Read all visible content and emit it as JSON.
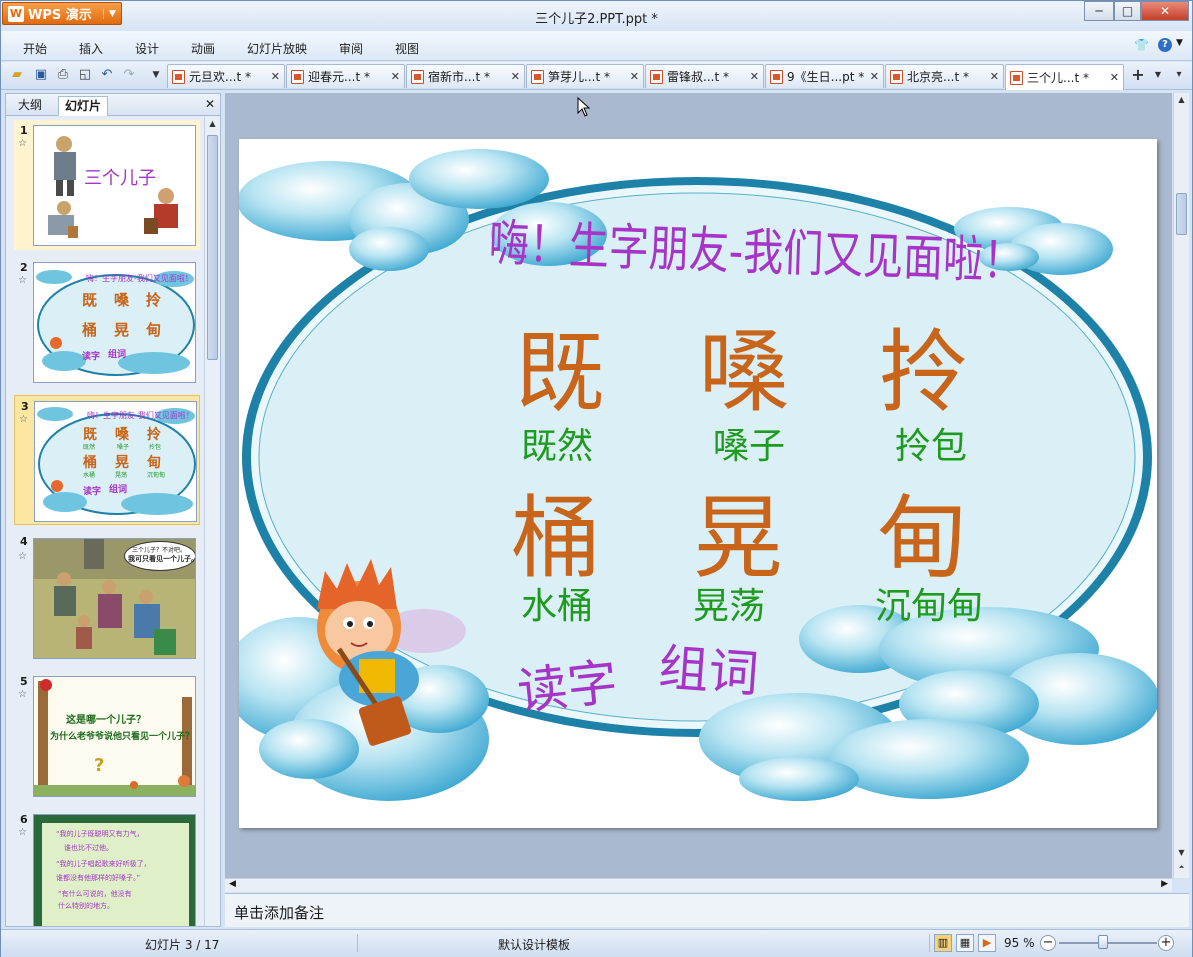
{
  "app": {
    "name": "WPS 演示",
    "window_title": "三个儿子2.PPT.ppt *",
    "controls": {
      "minimize": "─",
      "maximize": "□",
      "close": "✕"
    }
  },
  "menu": [
    "开始",
    "插入",
    "设计",
    "动画",
    "幻灯片放映",
    "审阅",
    "视图"
  ],
  "menu_right": {
    "shirt": "👕",
    "help": "?"
  },
  "toolbar": {
    "icons": [
      "open-icon",
      "save-icon",
      "print-icon",
      "preview-icon",
      "undo-icon",
      "redo-icon",
      "dropdown-icon"
    ],
    "tabs": [
      {
        "label": "元旦欢...t *"
      },
      {
        "label": "迎春元...t *"
      },
      {
        "label": "宿新市...t *"
      },
      {
        "label": "笋芽儿...t *"
      },
      {
        "label": "雷锋叔...t *"
      },
      {
        "label": "9《生日...pt *"
      },
      {
        "label": "北京亮...t *"
      },
      {
        "label": "三个儿...t *",
        "active": true
      }
    ],
    "tab_close": "✕",
    "new_tab": "+"
  },
  "panel": {
    "tabs": [
      "大纲",
      "幻灯片"
    ],
    "active_tab": "幻灯片",
    "close": "✕"
  },
  "thumbnails": [
    {
      "num": "1",
      "title": "三个儿子"
    },
    {
      "num": "2",
      "title": "嗨！生字朋友-我们又见面啦！",
      "chars": [
        "既",
        "嗓",
        "拎",
        "桶",
        "晃",
        "甸"
      ],
      "footer": [
        "读字",
        "组词"
      ]
    },
    {
      "num": "3",
      "title": "嗨！生字朋友-我们又见面啦！",
      "chars": [
        "既",
        "嗓",
        "拎",
        "桶",
        "晃",
        "甸"
      ],
      "words": [
        "既然",
        "嗓子",
        "拎包",
        "水桶",
        "晃荡",
        "沉甸甸"
      ],
      "footer": [
        "读字",
        "组词"
      ]
    },
    {
      "num": "4",
      "bubble": [
        "三个儿子？不对吧。",
        "我可只看见一个儿子。"
      ]
    },
    {
      "num": "5",
      "lines": [
        "这是哪一个儿子？",
        "为什么老爷爷说他只看见一个儿子？",
        "?"
      ]
    },
    {
      "num": "6",
      "lines": [
        "“我的儿子既聪明又有力气，",
        "谁也比不过他。",
        "“我的儿子唱起歌来好听极了，",
        "谁都没有他那样的好嗓子。”",
        "“有什么可说的，他没有",
        "什么特别的地方。"
      ]
    }
  ],
  "slide": {
    "title": "嗨！生字朋友-我们又见面啦！",
    "row1": {
      "chars": [
        "既",
        "嗓",
        "拎"
      ],
      "words": [
        "既然",
        "嗓子",
        "拎包"
      ]
    },
    "row2": {
      "chars": [
        "桶",
        "晃",
        "甸"
      ],
      "words": [
        "水桶",
        "晃荡",
        "沉甸甸"
      ]
    },
    "footer": [
      "读字",
      "组词"
    ],
    "colors": {
      "char": "#c8651a",
      "word": "#1e9a1e",
      "title": "#a634c7",
      "oval_fill": "#daf0f6",
      "oval_border": "#1e82a8"
    }
  },
  "notes": {
    "placeholder": "单击添加备注"
  },
  "status": {
    "slide_counter": "幻灯片 3 / 17",
    "template": "默认设计模板",
    "zoom": "95 %",
    "zoom_minus": "−",
    "zoom_plus": "+",
    "zoom_level_fraction": 0.45
  }
}
